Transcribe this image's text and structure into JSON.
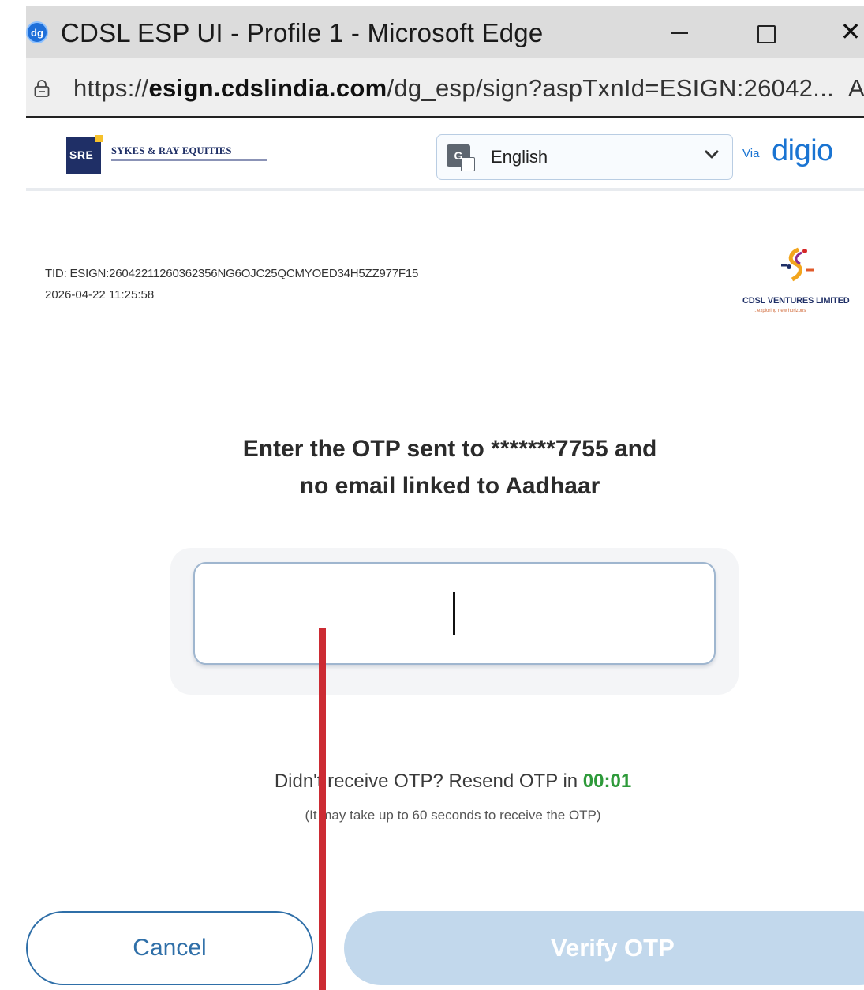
{
  "window": {
    "app_icon_text": "dg",
    "title": "CDSL ESP UI - Profile 1 - Microsoft Edge",
    "close_glyph": "✕"
  },
  "address_bar": {
    "url_scheme": "https://",
    "url_domain": "esign.cdslindia.com",
    "url_path": "/dg_esp/sign?aspTxnId=ESIGN:26042...",
    "trailing_text": "A"
  },
  "header": {
    "brand_logo_text": "SRE",
    "brand_name": "SYKES & RAY EQUITIES",
    "language": {
      "selected": "English",
      "icon": "translate-icon",
      "translate_glyph": "G"
    },
    "via_label": "Via",
    "provider": "digio",
    "accent_color": "#1a74d2"
  },
  "transaction": {
    "tid": "TID: ESIGN:26042211260362356NG6OJC25QCMYOED34H5ZZ977F15",
    "timestamp": "2026-04-22  11:25:58",
    "partner_logo_name": "CDSL VENTURES LIMITED",
    "partner_tagline": "...exploring new horizons"
  },
  "otp": {
    "prompt_line1": "Enter the OTP sent to *******7755 and",
    "prompt_line2": "no email linked to Aadhaar",
    "value": ""
  },
  "resend": {
    "text": "Didn't receive OTP? Resend OTP in ",
    "timer": "00:01",
    "timer_color": "#2e9a3a",
    "note": "(It may take up to 60 seconds to receive the OTP)"
  },
  "actions": {
    "cancel_label": "Cancel",
    "verify_label": "Verify OTP",
    "verify_disabled": true
  },
  "annotation": {
    "color": "#cc2b33"
  }
}
